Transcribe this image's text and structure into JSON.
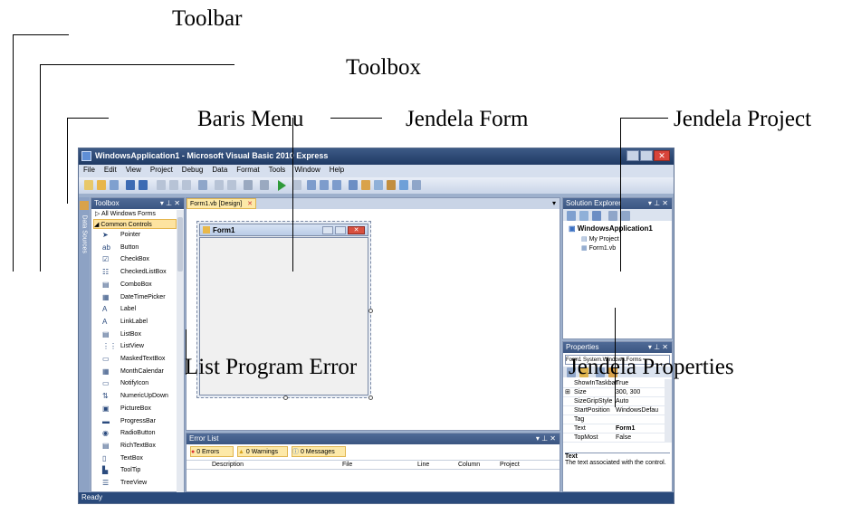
{
  "callouts": {
    "toolbar": "Toolbar",
    "toolbox": "Toolbox",
    "menubar": "Baris Menu",
    "form_window": "Jendela Form",
    "project_window": "Jendela Project",
    "error_list": "List Program Error",
    "properties_window": "Jendela Properties"
  },
  "window": {
    "title": "WindowsApplication1 - Microsoft Visual Basic 2010 Express"
  },
  "menu": [
    "File",
    "Edit",
    "View",
    "Project",
    "Debug",
    "Data",
    "Format",
    "Tools",
    "Window",
    "Help"
  ],
  "side_tab": "Data Sources",
  "toolbox": {
    "title": "Toolbox",
    "group_all": "All Windows Forms",
    "group_common": "Common Controls",
    "items": [
      "Pointer",
      "Button",
      "CheckBox",
      "CheckedListBox",
      "ComboBox",
      "DateTimePicker",
      "Label",
      "LinkLabel",
      "ListBox",
      "ListView",
      "MaskedTextBox",
      "MonthCalendar",
      "NotifyIcon",
      "NumericUpDown",
      "PictureBox",
      "ProgressBar",
      "RadioButton",
      "RichTextBox",
      "TextBox",
      "ToolTip",
      "TreeView"
    ]
  },
  "designer": {
    "tab": "Form1.vb [Design]",
    "form_title": "Form1"
  },
  "solution_explorer": {
    "title": "Solution Explorer",
    "root": "WindowsApplication1",
    "items": [
      "My Project",
      "Form1.vb"
    ]
  },
  "properties": {
    "title": "Properties",
    "selector": "Form1 System.Windows.Forms",
    "rows": [
      {
        "k": "ShowInTaskbar",
        "v": "True"
      },
      {
        "k": "Size",
        "v": "300, 300"
      },
      {
        "k": "SizeGripStyle",
        "v": "Auto"
      },
      {
        "k": "StartPosition",
        "v": "WindowsDefau"
      },
      {
        "k": "Tag",
        "v": ""
      },
      {
        "k": "Text",
        "v": "Form1"
      },
      {
        "k": "TopMost",
        "v": "False"
      }
    ],
    "desc_title": "Text",
    "desc_text": "The text associated with the control."
  },
  "error_list": {
    "title": "Error List",
    "errors": "0 Errors",
    "warnings": "0 Warnings",
    "messages": "0 Messages",
    "columns": [
      "Description",
      "File",
      "Line",
      "Column",
      "Project"
    ]
  },
  "status": "Ready",
  "colors": {
    "accent": "#3b5682",
    "ide_bg": "#9db0cc",
    "error_tab": "#fde9a8"
  }
}
